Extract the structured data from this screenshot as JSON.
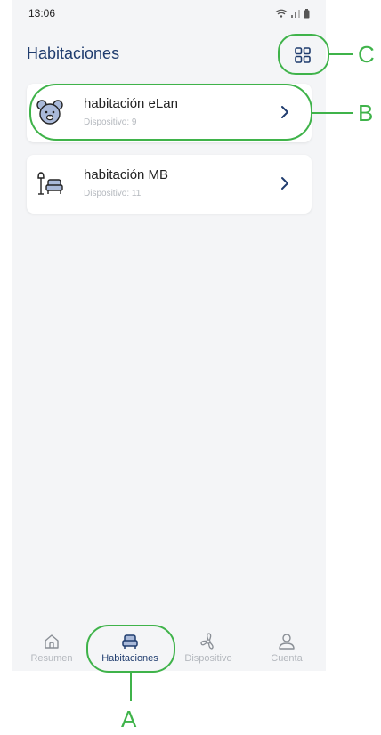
{
  "status_bar": {
    "time": "13:06"
  },
  "header": {
    "title": "Habitaciones"
  },
  "rooms": [
    {
      "name": "habitación eLan",
      "subtitle": "Dispositivo: 9",
      "icon": "bear-icon"
    },
    {
      "name": "habitación MB",
      "subtitle": "Dispositivo: 11",
      "icon": "lamp-armchair-icon"
    }
  ],
  "bottom_nav": [
    {
      "label": "Resumen",
      "icon": "home-icon",
      "active": false
    },
    {
      "label": "Habitaciones",
      "icon": "armchair-icon",
      "active": true
    },
    {
      "label": "Dispositivo",
      "icon": "fan-icon",
      "active": false
    },
    {
      "label": "Cuenta",
      "icon": "user-icon",
      "active": false
    }
  ],
  "annotations": {
    "a": "A",
    "b": "B",
    "c": "C"
  },
  "colors": {
    "accent": "#1f3c6e",
    "callout": "#3fb34a",
    "muted": "#b4b8be",
    "icon_fill": "#a9b9d9"
  }
}
